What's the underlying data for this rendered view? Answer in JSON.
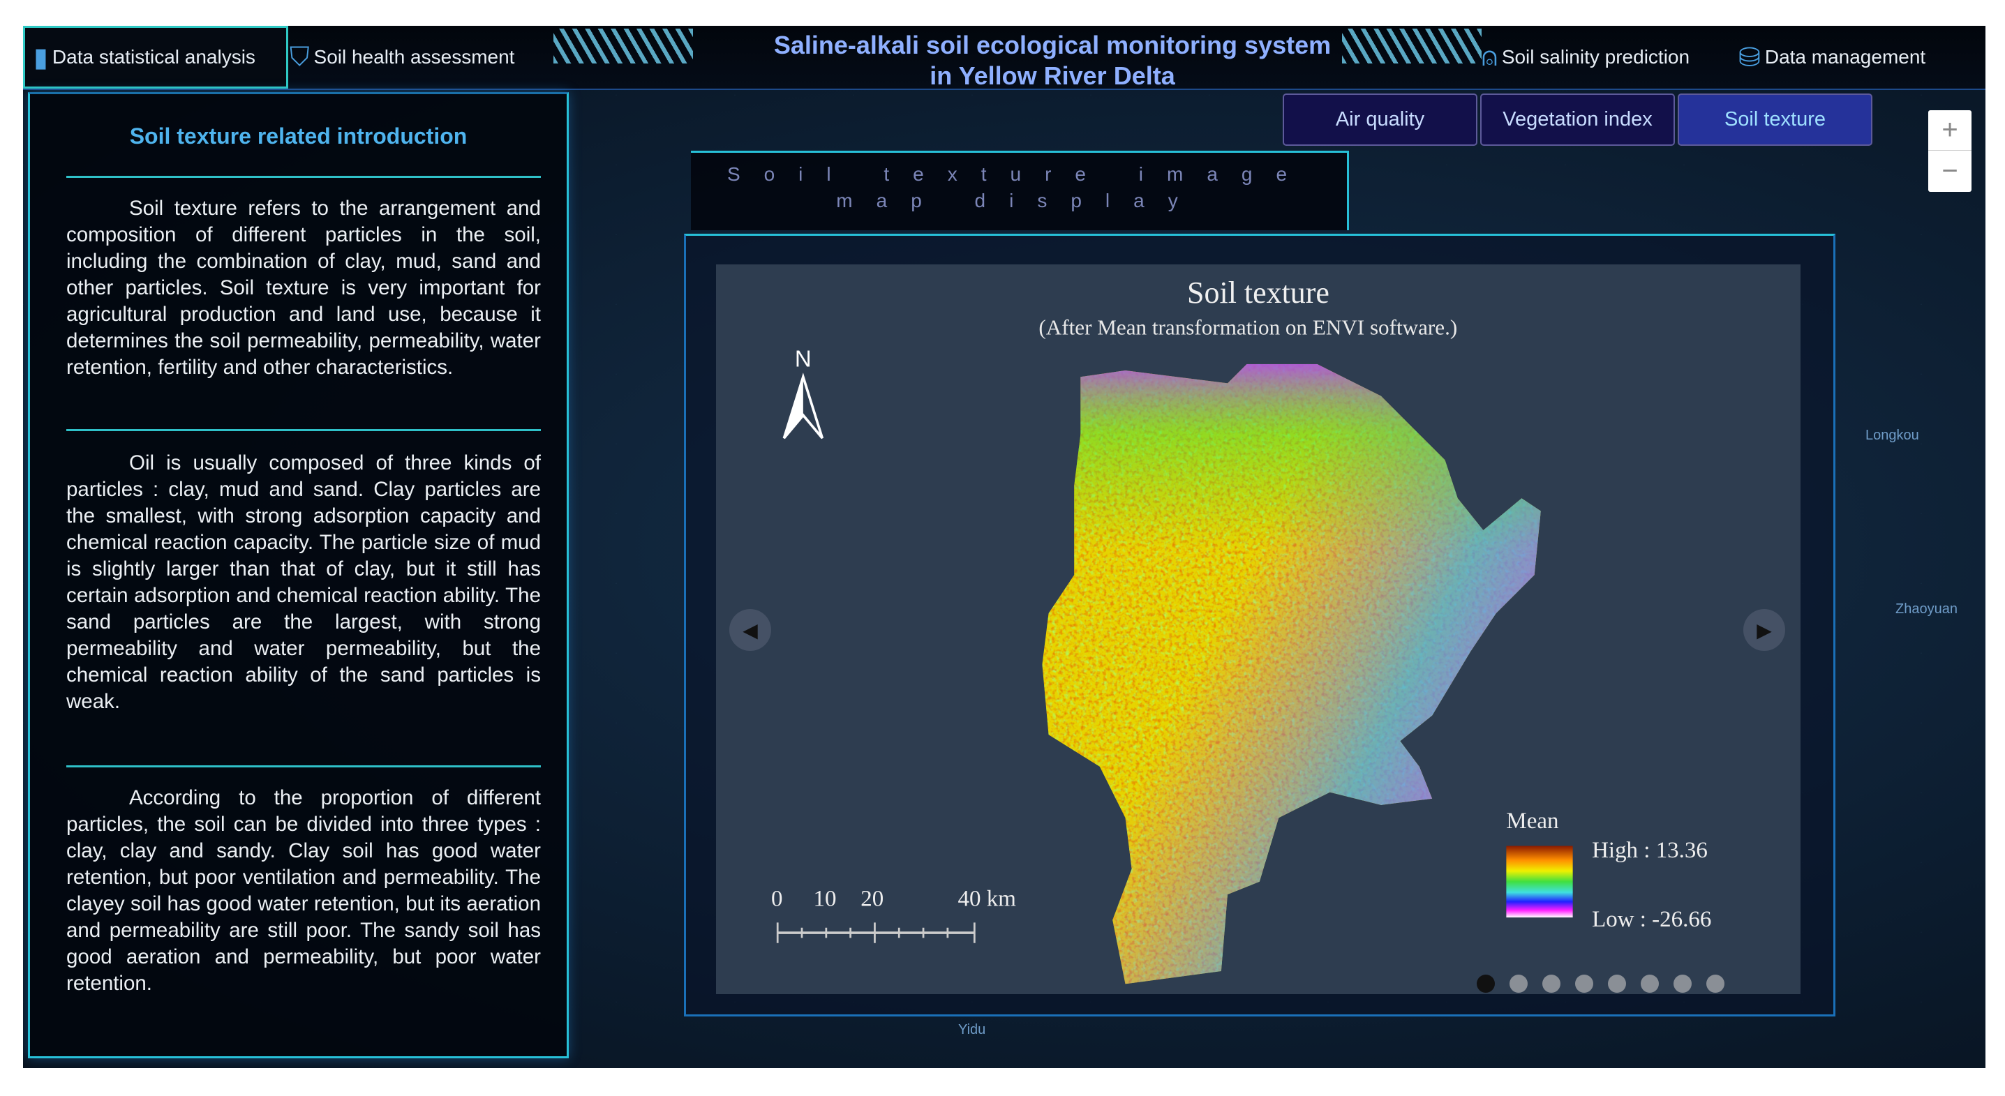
{
  "header": {
    "title_line1": "Saline-alkali soil ecological monitoring system",
    "title_line2": "in Yellow River Delta",
    "nav": [
      {
        "label": "Data statistical analysis",
        "icon": "bar-chart-icon"
      },
      {
        "label": "Soil health assessment",
        "icon": "shield-icon"
      },
      {
        "label": "Soil salinity prediction",
        "icon": "alarm-icon"
      },
      {
        "label": "Data management",
        "icon": "database-icon"
      }
    ]
  },
  "left_panel": {
    "title": "Soil texture related introduction",
    "paragraphs": [
      "Soil texture refers to the arrangement and composition of different particles in the soil, including the combination of clay, mud, sand and other particles. Soil texture is very important for agricultural production and land use, because it determines the soil permeability, permeability, water retention, fertility and other characteristics.",
      "Oil is usually composed of three kinds of particles : clay, mud and sand. Clay particles are the smallest, with strong adsorption capacity and chemical reaction capacity. The particle size of mud is slightly larger than that of clay, but it still has certain adsorption and chemical reaction ability. The sand particles are the largest, with strong permeability and water permeability, but the chemical reaction ability of the sand particles is weak.",
      "According to the proportion of different particles, the soil can be divided into three types : clay, clay and sandy. Clay soil has good water retention, but poor ventilation and permeability. The clayey soil has good water retention, but its aeration and permeability are still poor. The sandy soil has good aeration and permeability, but poor water retention."
    ]
  },
  "tabs": [
    {
      "label": "Air quality"
    },
    {
      "label": "Vegetation index"
    },
    {
      "label": "Soil texture",
      "active": true
    }
  ],
  "zoom": {
    "plus": "+",
    "minus": "−"
  },
  "map_display_title": "Soil texture image map display",
  "map": {
    "title": "Soil texture",
    "subtitle": "(After Mean  transformation on ENVI software.)",
    "north": "N",
    "scale_labels": [
      "0",
      "10",
      "20",
      "40 km"
    ],
    "legend": {
      "title": "Mean",
      "high": "High : 13.36",
      "low": "Low : -26.66"
    },
    "carousel_count": 8,
    "carousel_active": 1
  },
  "cities": [
    "Longkou",
    "Zhaoyuan",
    "Yidu"
  ],
  "colors": {
    "accent": "#27c0d8",
    "title": "#8fb0ff",
    "panel_title": "#4fb4ee"
  }
}
